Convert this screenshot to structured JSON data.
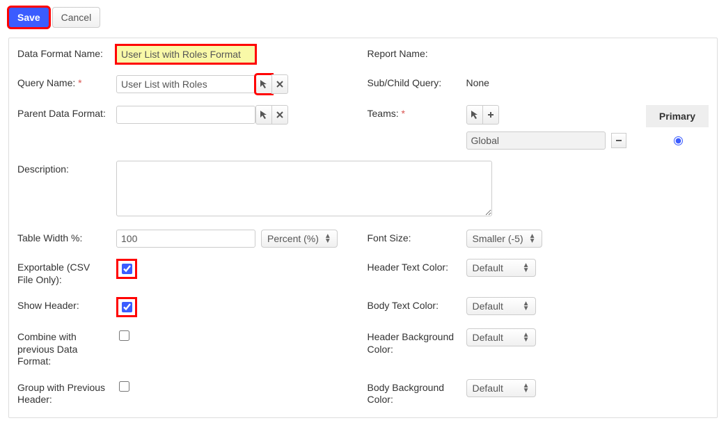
{
  "toolbar": {
    "save": "Save",
    "cancel": "Cancel"
  },
  "labels": {
    "data_format_name": "Data Format Name:",
    "report_name": "Report Name:",
    "query_name": "Query Name:",
    "sub_child_query": "Sub/Child Query:",
    "parent_data_format": "Parent Data Format:",
    "teams": "Teams:",
    "description": "Description:",
    "table_width": "Table Width %:",
    "font_size": "Font Size:",
    "exportable": "Exportable (CSV File Only):",
    "header_text_color": "Header Text Color:",
    "show_header": "Show Header:",
    "body_text_color": "Body Text Color:",
    "combine_prev": "Combine with previous Data Format:",
    "header_bg_color": "Header Background Color:",
    "group_prev": "Group with Previous Header:",
    "body_bg_color": "Body Background Color:"
  },
  "values": {
    "data_format_name": "User List with Roles Format",
    "report_name": "",
    "query_name": "User List with Roles",
    "sub_child_query": "None",
    "parent_data_format": "",
    "description": "",
    "table_width": "100",
    "table_width_unit": "Percent (%)",
    "font_size": "Smaller (-5)",
    "header_text_color": "Default",
    "body_text_color": "Default",
    "header_bg_color": "Default",
    "body_bg_color": "Default",
    "exportable_checked": true,
    "show_header_checked": true,
    "combine_prev_checked": false,
    "group_prev_checked": false
  },
  "teams": {
    "primary_header": "Primary",
    "items": [
      {
        "name": "Global",
        "primary": true
      }
    ]
  }
}
